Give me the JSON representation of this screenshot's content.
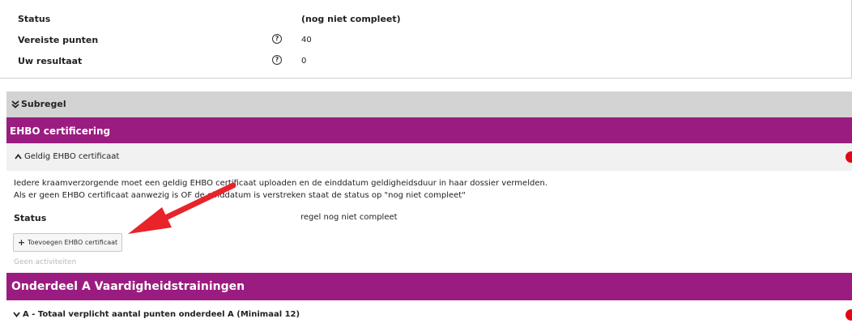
{
  "summary": {
    "rows": [
      {
        "label": "Status",
        "value": "(nog niet compleet)"
      },
      {
        "label": "Vereiste punten",
        "value": "40"
      },
      {
        "label": "Uw resultaat",
        "value": "0"
      }
    ],
    "help_glyph": "?"
  },
  "subregel": {
    "label": "Subregel",
    "icon": "double-chevron-down-icon"
  },
  "ehbo": {
    "header": "EHBO certificering",
    "item_title": "Geldig EHBO certificaat",
    "description_line1": "Iedere kraamverzorgende moet een geldig EHBO certificaat uploaden en de einddatum geldigheidsduur in haar dossier vermelden.",
    "description_line2": "Als er geen EHBO certificaat aanwezig is OF de einddatum is verstreken staat de status op \"nog niet compleet\"",
    "status_label": "Status",
    "status_value": "regel nog niet compleet",
    "add_button": "Toevoegen EHBO certificaat",
    "no_activities": "Geen activiteiten"
  },
  "onderdeel_a": {
    "header": "Onderdeel A Vaardigheidstrainingen",
    "item_title": "A - Totaal verplicht aantal punten onderdeel A (Minimaal 12)"
  },
  "colors": {
    "purple": "#9b1c80",
    "status_dot": "#e30613",
    "annotation_arrow": "#e8232a"
  }
}
